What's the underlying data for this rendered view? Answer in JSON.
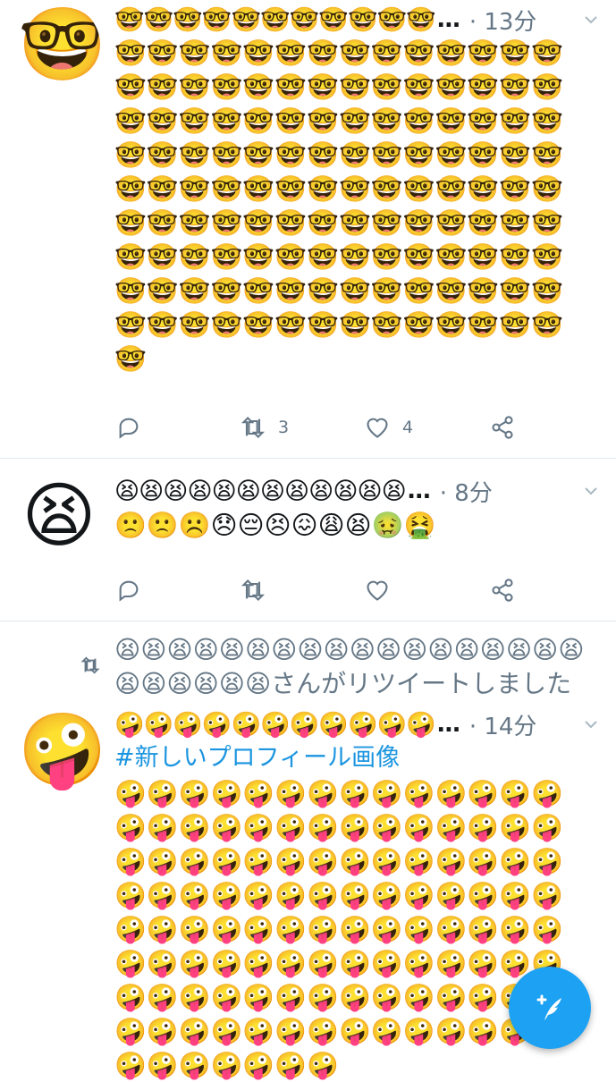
{
  "colors": {
    "accent": "#1da1f2",
    "link": "#1b95e0",
    "muted": "#657786",
    "divider": "#e1e8ed"
  },
  "tweets": [
    {
      "avatar_icon": "nerd-face-emoji",
      "avatar": "🤓",
      "name": "🤓🤓🤓🤓🤓🤓🤓🤓🤓🤓🤓",
      "ellipsis": "…",
      "time": "· 13分",
      "body": "🤓🤓🤓🤓🤓🤓🤓🤓🤓🤓🤓🤓🤓🤓🤓🤓🤓🤓🤓🤓🤓🤓🤓🤓🤓🤓🤓🤓🤓🤓🤓🤓🤓🤓🤓🤓🤓🤓🤓🤓🤓🤓🤓🤓🤓🤓🤓🤓🤓🤓🤓🤓🤓🤓🤓🤓🤓🤓🤓🤓🤓🤓🤓🤓🤓🤓🤓🤓🤓🤓🤓🤓🤓🤓🤓🤓🤓🤓🤓🤓🤓🤓🤓🤓🤓🤓🤓🤓🤓🤓🤓🤓🤓🤓🤓🤓🤓🤓🤓🤓🤓🤓🤓🤓🤓🤓🤓🤓🤓🤓🤓🤓🤓🤓🤓🤓🤓🤓🤓🤓🤓🤓🤓🤓🤓🤓🤓",
      "retweet_count": "3",
      "like_count": "4"
    },
    {
      "avatar_icon": "tired-face-emoji",
      "avatar": "😫",
      "name": "😫😫😫😫😫😫😫😫😫😫😫😫",
      "ellipsis": "…",
      "time": "· 8分",
      "body": "🙁🙁☹️😞😔😣😖😩😫🤢🤮",
      "retweet_count": "",
      "like_count": ""
    },
    {
      "retweeter_line": "😫😫😫😫😫😫😫😫😫😫😫😫😫😫😫😫😫😫😫😫😫😫😫😫さんがリツイートしました",
      "avatar_icon": "zany-face-emoji",
      "avatar": "🤪",
      "name": "🤪🤪🤪🤪🤪🤪🤪🤪🤪🤪🤪",
      "ellipsis": "…",
      "time": "· 14分",
      "hashtag": "#新しいプロフィール画像",
      "body": "🤪🤪🤪🤪🤪🤪🤪🤪🤪🤪🤪🤪🤪🤪🤪🤪🤪🤪🤪🤪🤪🤪🤪🤪🤪🤪🤪🤪🤪🤪🤪🤪🤪🤪🤪🤪🤪🤪🤪🤪🤪🤪🤪🤪🤪🤪🤪🤪🤪🤪🤪🤪🤪🤪🤪🤪🤪🤪🤪🤪🤪🤪🤪🤪🤪🤪🤪🤪🤪🤪🤪🤪🤪🤪🤪🤪🤪🤪🤪🤪🤪🤪🤪🤪🤪🤪🤪🤪🤪🤪🤪🤪🤪🤪🤪🤪🤪🤪🤪🤪🤪🤪🤪🤪🤪🤪🤪🤪🤪🤪🤪🤪🤪🤪🤪🤪🤪🤪🤪"
    }
  ],
  "fab": {
    "icon": "compose-tweet-icon"
  }
}
